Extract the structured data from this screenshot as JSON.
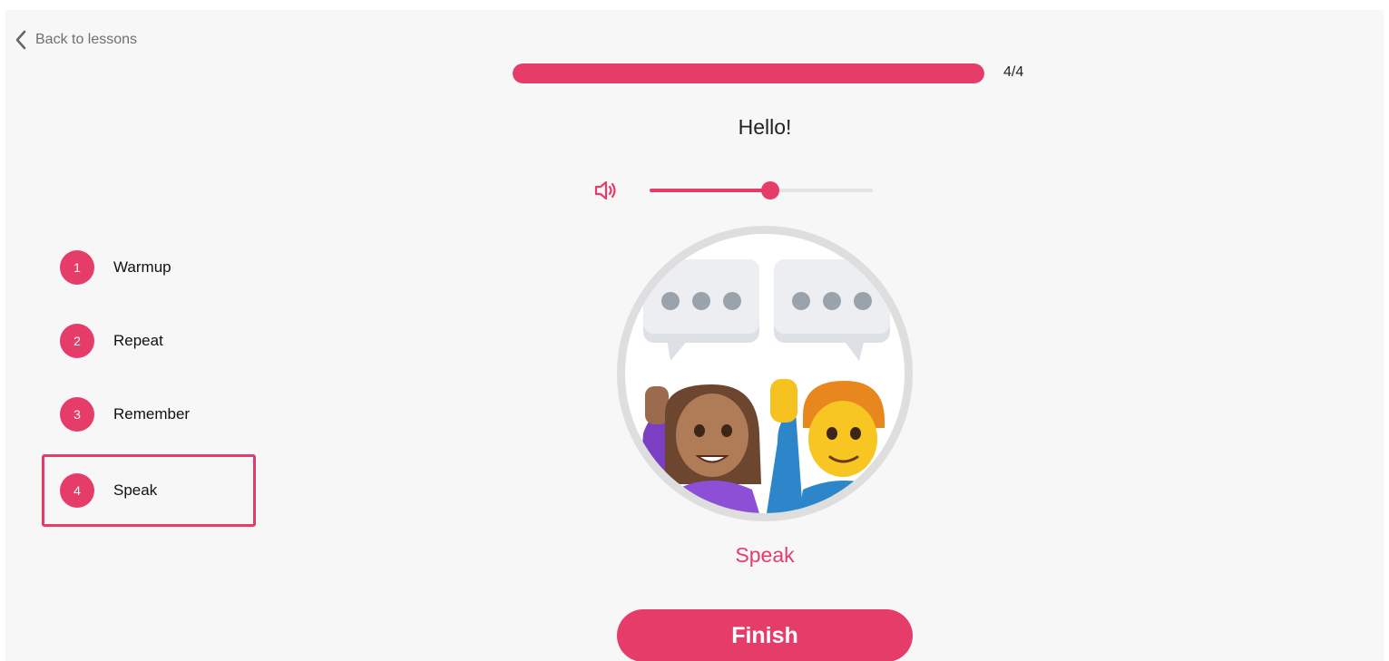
{
  "nav": {
    "back_label": "Back to lessons"
  },
  "progress": {
    "current": 4,
    "total": 4,
    "fraction": 1.0,
    "label": "4/4"
  },
  "prompt": {
    "text": "Hello!"
  },
  "audio": {
    "icon": "speaker-icon",
    "volume_fraction": 0.54
  },
  "steps": [
    {
      "number": "1",
      "label": "Warmup",
      "active": false
    },
    {
      "number": "2",
      "label": "Repeat",
      "active": false
    },
    {
      "number": "3",
      "label": "Remember",
      "active": false
    },
    {
      "number": "4",
      "label": "Speak",
      "active": true
    }
  ],
  "illustration": {
    "icon": "two-people-talking-icon"
  },
  "activity": {
    "label": "Speak"
  },
  "actions": {
    "finish_label": "Finish"
  },
  "colors": {
    "accent": "#e63c6a",
    "background": "#f7f7f7",
    "track": "#e4e4e4"
  }
}
